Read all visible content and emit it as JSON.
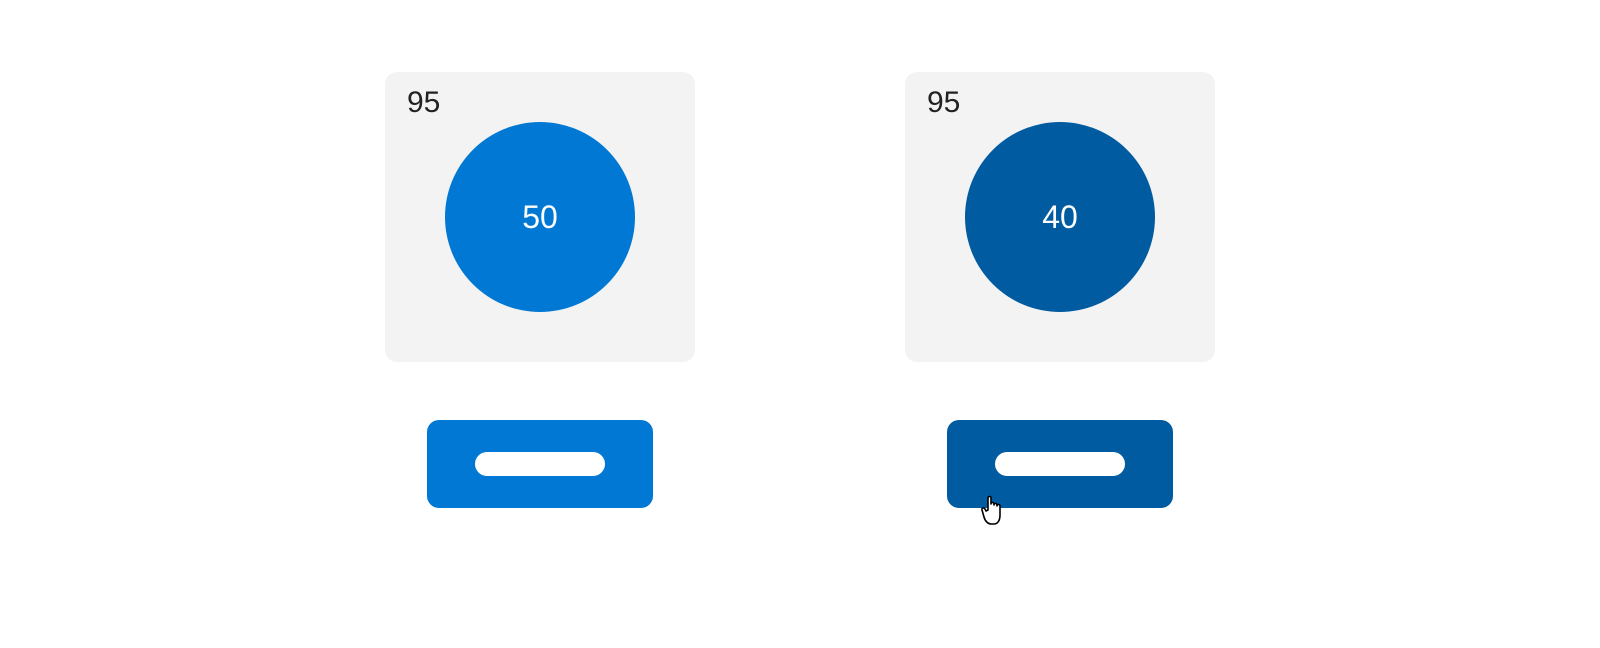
{
  "colors": {
    "card_bg": "#f3f3f3",
    "accent": "#0078d4",
    "accent_dark": "#005ba1",
    "text": "#222222",
    "on_accent": "#ffffff"
  },
  "cards": [
    {
      "label": "95",
      "circle_value": "50",
      "state": "normal"
    },
    {
      "label": "95",
      "circle_value": "40",
      "state": "hover"
    }
  ]
}
